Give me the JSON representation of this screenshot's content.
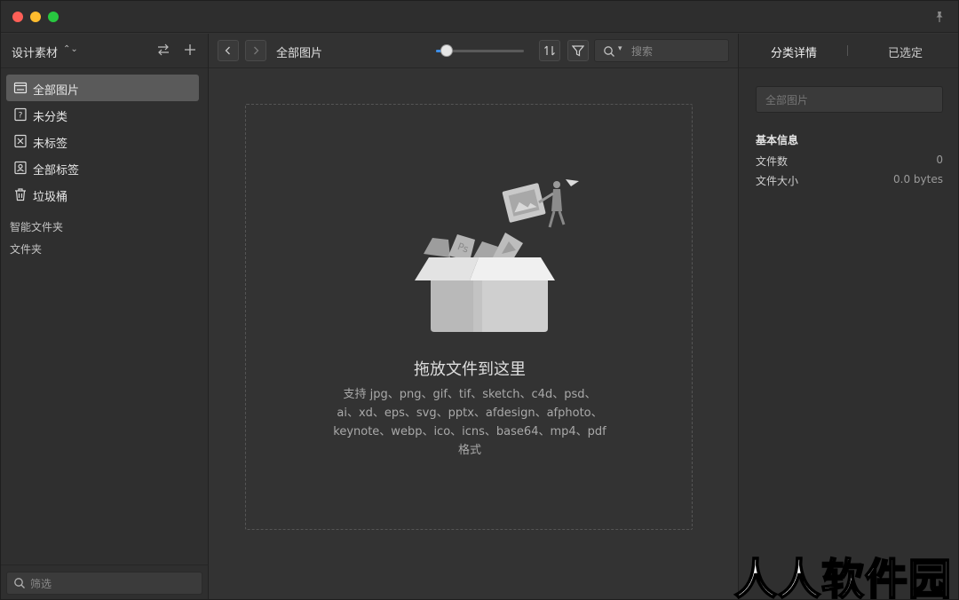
{
  "window": {
    "buttons": [
      "close",
      "minimize",
      "zoom"
    ],
    "pin_icon": "pin-icon"
  },
  "sidebar": {
    "library_title": "设计素材",
    "library_switch_glyph": "⌃⌄",
    "items": [
      {
        "label": "全部图片",
        "icon": "all-images-icon",
        "active": true
      },
      {
        "label": "未分类",
        "icon": "uncategorized-icon",
        "active": false
      },
      {
        "label": "未标签",
        "icon": "untagged-icon",
        "active": false
      },
      {
        "label": "全部标签",
        "icon": "all-tags-icon",
        "active": false
      },
      {
        "label": "垃圾桶",
        "icon": "trash-icon",
        "active": false
      }
    ],
    "smart_folders_label": "智能文件夹",
    "folders_label": "文件夹",
    "filter_placeholder": "筛选"
  },
  "toolbar": {
    "title": "全部图片",
    "zoom_level": 0.12,
    "search_placeholder": "搜索"
  },
  "dropzone": {
    "title": "拖放文件到这里",
    "desc_line1": "支持 jpg、png、gif、tif、sketch、c4d、psd、",
    "desc_line2": "ai、xd、eps、svg、pptx、afdesign、afphoto、",
    "desc_line3": "keynote、webp、ico、icns、base64、mp4、pdf",
    "desc_line4": "格式"
  },
  "right_panel": {
    "tab_details": "分类详情",
    "tab_selected": "已选定",
    "name_placeholder": "全部图片",
    "info_title": "基本信息",
    "file_count_label": "文件数",
    "file_count_value": "0",
    "file_size_label": "文件大小",
    "file_size_value": "0.0 bytes"
  },
  "watermark": "人人软件园",
  "colors": {
    "accent": "#3d8ee8",
    "background": "#333333",
    "sidebar": "#2f2f2f",
    "active_item": "#5a5a5a"
  }
}
